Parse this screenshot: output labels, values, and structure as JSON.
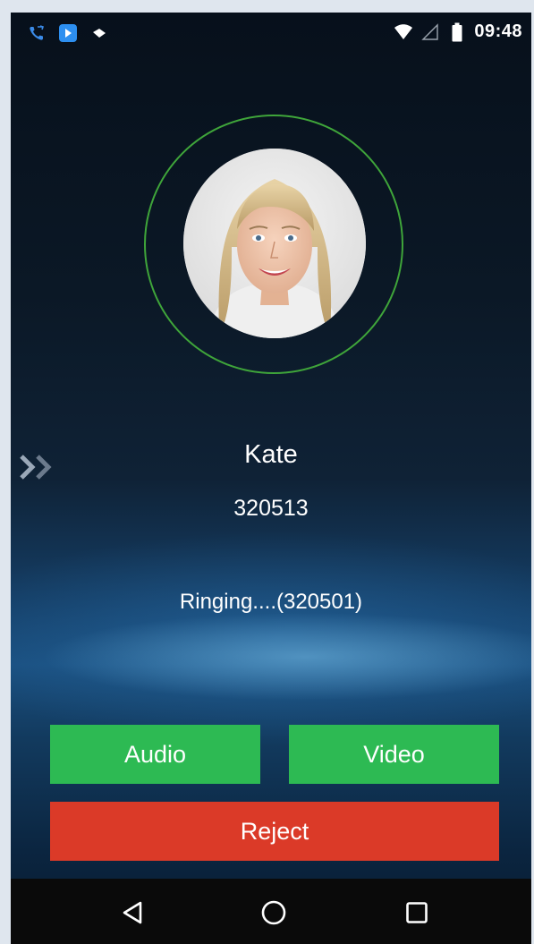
{
  "status_bar": {
    "time": "09:48",
    "icons": [
      "phone-call-icon",
      "app-icon",
      "notification-icon",
      "wifi-icon",
      "signal-icon",
      "battery-icon"
    ]
  },
  "caller": {
    "name": "Kate",
    "number": "320513",
    "status": "Ringing....(320501)"
  },
  "actions": {
    "audio_label": "Audio",
    "video_label": "Video",
    "reject_label": "Reject"
  },
  "colors": {
    "accept": "#2dba53",
    "reject": "#db3a28",
    "ring": "#3fa53a"
  },
  "nav": {
    "icons": [
      "back-icon",
      "home-icon",
      "recents-icon"
    ]
  }
}
